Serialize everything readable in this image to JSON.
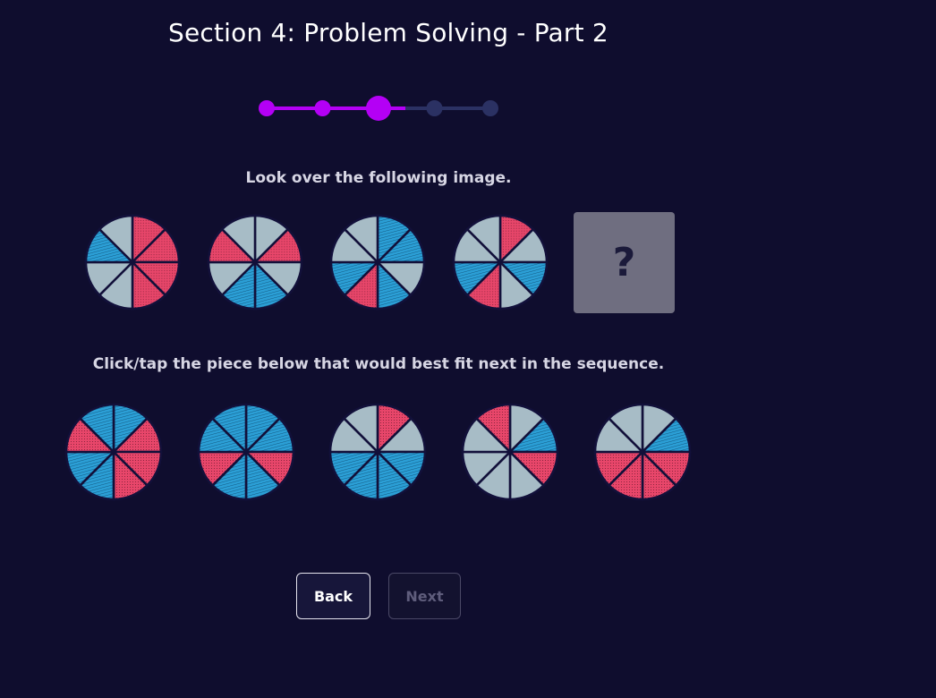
{
  "header": {
    "title": "Section 4: Problem Solving - Part 2"
  },
  "progress": {
    "total_steps": 5,
    "current_step": 3,
    "active_color": "#b400f5",
    "inactive_color": "#2b3163"
  },
  "question": {
    "instruction": "Look over the following image.",
    "placeholder": "?",
    "sequence": [
      [
        "red",
        "red",
        "red",
        "red",
        "grey",
        "grey",
        "blue",
        "grey"
      ],
      [
        "grey",
        "red",
        "grey",
        "blue",
        "blue",
        "grey",
        "red",
        "grey"
      ],
      [
        "blue",
        "blue",
        "grey",
        "blue",
        "red",
        "blue",
        "grey",
        "grey"
      ],
      [
        "red",
        "grey",
        "blue",
        "grey",
        "red",
        "blue",
        "grey",
        "grey"
      ]
    ]
  },
  "answers": {
    "instruction": "Click/tap the piece below that would best fit next in the sequence.",
    "options": [
      [
        "blue",
        "red",
        "red",
        "red",
        "blue",
        "blue",
        "red",
        "blue"
      ],
      [
        "blue",
        "blue",
        "red",
        "blue",
        "blue",
        "red",
        "blue",
        "blue"
      ],
      [
        "red",
        "grey",
        "blue",
        "blue",
        "blue",
        "blue",
        "grey",
        "grey"
      ],
      [
        "grey",
        "blue",
        "red",
        "grey",
        "grey",
        "grey",
        "grey",
        "red"
      ],
      [
        "grey",
        "blue",
        "red",
        "red",
        "red",
        "red",
        "grey",
        "grey"
      ]
    ]
  },
  "colors": {
    "red": "#e8466a",
    "blue": "#2b9fd6",
    "grey": "#a7bcc6",
    "divider": "#12103a"
  },
  "buttons": {
    "back_label": "Back",
    "next_label": "Next"
  }
}
